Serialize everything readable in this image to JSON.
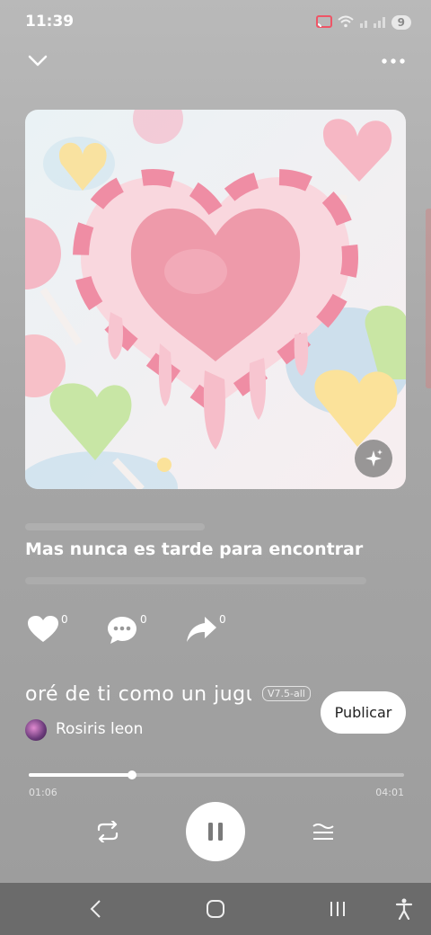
{
  "status": {
    "time": "11:39",
    "battery": "9"
  },
  "header": {
    "collapse_icon": "chevron-down-icon",
    "menu_icon": "more-dots-icon"
  },
  "player": {
    "lyric_current": "Mas nunca es tarde para encontrar",
    "likes": "0",
    "comments": "0",
    "shares": "0",
    "marquee_text": "oré de ti como un jugu",
    "version": "V7.5-all",
    "publish_label": "Publicar",
    "user_name": "Rosiris leon",
    "elapsed": "01:06",
    "duration": "04:01",
    "progress_fraction": 0.274
  },
  "colors": {
    "play_button": "#ffffff",
    "navbar": "#6b6b6b"
  }
}
